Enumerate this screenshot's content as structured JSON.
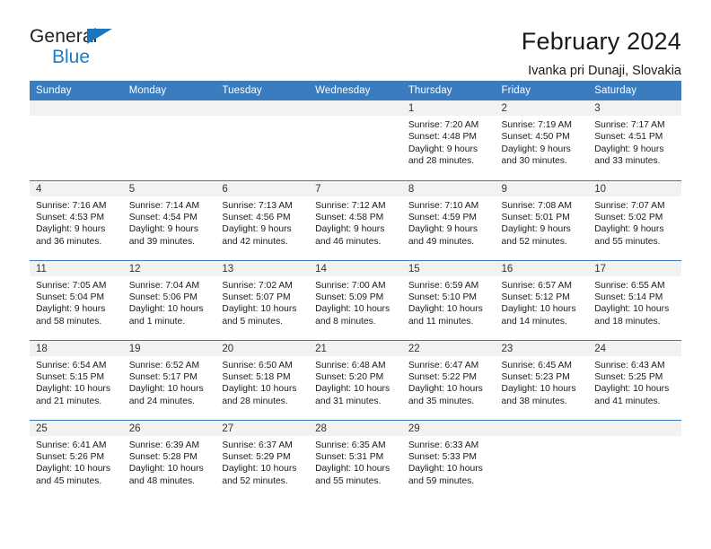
{
  "brand": {
    "name_part1": "General",
    "name_part2": "Blue",
    "triangle_color": "#1b76bd",
    "text_color": "#231f20"
  },
  "header": {
    "title": "February 2024",
    "subtitle": "Ivanka pri Dunaji, Slovakia"
  },
  "theme": {
    "header_bg": "#3a7cbd",
    "header_text": "#ffffff",
    "daynum_bg": "#f2f2f2",
    "cell_bg": "#ffffff",
    "grid_line": "#3a7cbd"
  },
  "weekday_headers": [
    "Sunday",
    "Monday",
    "Tuesday",
    "Wednesday",
    "Thursday",
    "Friday",
    "Saturday"
  ],
  "weeks": [
    [
      {
        "day": "",
        "empty": true,
        "sunrise": "",
        "sunset": "",
        "daylight_line1": "",
        "daylight_line2": ""
      },
      {
        "day": "",
        "empty": true,
        "sunrise": "",
        "sunset": "",
        "daylight_line1": "",
        "daylight_line2": ""
      },
      {
        "day": "",
        "empty": true,
        "sunrise": "",
        "sunset": "",
        "daylight_line1": "",
        "daylight_line2": ""
      },
      {
        "day": "",
        "empty": true,
        "sunrise": "",
        "sunset": "",
        "daylight_line1": "",
        "daylight_line2": ""
      },
      {
        "day": "1",
        "sunrise": "Sunrise: 7:20 AM",
        "sunset": "Sunset: 4:48 PM",
        "daylight_line1": "Daylight: 9 hours",
        "daylight_line2": "and 28 minutes."
      },
      {
        "day": "2",
        "sunrise": "Sunrise: 7:19 AM",
        "sunset": "Sunset: 4:50 PM",
        "daylight_line1": "Daylight: 9 hours",
        "daylight_line2": "and 30 minutes."
      },
      {
        "day": "3",
        "sunrise": "Sunrise: 7:17 AM",
        "sunset": "Sunset: 4:51 PM",
        "daylight_line1": "Daylight: 9 hours",
        "daylight_line2": "and 33 minutes."
      }
    ],
    [
      {
        "day": "4",
        "sunrise": "Sunrise: 7:16 AM",
        "sunset": "Sunset: 4:53 PM",
        "daylight_line1": "Daylight: 9 hours",
        "daylight_line2": "and 36 minutes."
      },
      {
        "day": "5",
        "sunrise": "Sunrise: 7:14 AM",
        "sunset": "Sunset: 4:54 PM",
        "daylight_line1": "Daylight: 9 hours",
        "daylight_line2": "and 39 minutes."
      },
      {
        "day": "6",
        "sunrise": "Sunrise: 7:13 AM",
        "sunset": "Sunset: 4:56 PM",
        "daylight_line1": "Daylight: 9 hours",
        "daylight_line2": "and 42 minutes."
      },
      {
        "day": "7",
        "sunrise": "Sunrise: 7:12 AM",
        "sunset": "Sunset: 4:58 PM",
        "daylight_line1": "Daylight: 9 hours",
        "daylight_line2": "and 46 minutes."
      },
      {
        "day": "8",
        "sunrise": "Sunrise: 7:10 AM",
        "sunset": "Sunset: 4:59 PM",
        "daylight_line1": "Daylight: 9 hours",
        "daylight_line2": "and 49 minutes."
      },
      {
        "day": "9",
        "sunrise": "Sunrise: 7:08 AM",
        "sunset": "Sunset: 5:01 PM",
        "daylight_line1": "Daylight: 9 hours",
        "daylight_line2": "and 52 minutes."
      },
      {
        "day": "10",
        "sunrise": "Sunrise: 7:07 AM",
        "sunset": "Sunset: 5:02 PM",
        "daylight_line1": "Daylight: 9 hours",
        "daylight_line2": "and 55 minutes."
      }
    ],
    [
      {
        "day": "11",
        "sunrise": "Sunrise: 7:05 AM",
        "sunset": "Sunset: 5:04 PM",
        "daylight_line1": "Daylight: 9 hours",
        "daylight_line2": "and 58 minutes."
      },
      {
        "day": "12",
        "sunrise": "Sunrise: 7:04 AM",
        "sunset": "Sunset: 5:06 PM",
        "daylight_line1": "Daylight: 10 hours",
        "daylight_line2": "and 1 minute."
      },
      {
        "day": "13",
        "sunrise": "Sunrise: 7:02 AM",
        "sunset": "Sunset: 5:07 PM",
        "daylight_line1": "Daylight: 10 hours",
        "daylight_line2": "and 5 minutes."
      },
      {
        "day": "14",
        "sunrise": "Sunrise: 7:00 AM",
        "sunset": "Sunset: 5:09 PM",
        "daylight_line1": "Daylight: 10 hours",
        "daylight_line2": "and 8 minutes."
      },
      {
        "day": "15",
        "sunrise": "Sunrise: 6:59 AM",
        "sunset": "Sunset: 5:10 PM",
        "daylight_line1": "Daylight: 10 hours",
        "daylight_line2": "and 11 minutes."
      },
      {
        "day": "16",
        "sunrise": "Sunrise: 6:57 AM",
        "sunset": "Sunset: 5:12 PM",
        "daylight_line1": "Daylight: 10 hours",
        "daylight_line2": "and 14 minutes."
      },
      {
        "day": "17",
        "sunrise": "Sunrise: 6:55 AM",
        "sunset": "Sunset: 5:14 PM",
        "daylight_line1": "Daylight: 10 hours",
        "daylight_line2": "and 18 minutes."
      }
    ],
    [
      {
        "day": "18",
        "sunrise": "Sunrise: 6:54 AM",
        "sunset": "Sunset: 5:15 PM",
        "daylight_line1": "Daylight: 10 hours",
        "daylight_line2": "and 21 minutes."
      },
      {
        "day": "19",
        "sunrise": "Sunrise: 6:52 AM",
        "sunset": "Sunset: 5:17 PM",
        "daylight_line1": "Daylight: 10 hours",
        "daylight_line2": "and 24 minutes."
      },
      {
        "day": "20",
        "sunrise": "Sunrise: 6:50 AM",
        "sunset": "Sunset: 5:18 PM",
        "daylight_line1": "Daylight: 10 hours",
        "daylight_line2": "and 28 minutes."
      },
      {
        "day": "21",
        "sunrise": "Sunrise: 6:48 AM",
        "sunset": "Sunset: 5:20 PM",
        "daylight_line1": "Daylight: 10 hours",
        "daylight_line2": "and 31 minutes."
      },
      {
        "day": "22",
        "sunrise": "Sunrise: 6:47 AM",
        "sunset": "Sunset: 5:22 PM",
        "daylight_line1": "Daylight: 10 hours",
        "daylight_line2": "and 35 minutes."
      },
      {
        "day": "23",
        "sunrise": "Sunrise: 6:45 AM",
        "sunset": "Sunset: 5:23 PM",
        "daylight_line1": "Daylight: 10 hours",
        "daylight_line2": "and 38 minutes."
      },
      {
        "day": "24",
        "sunrise": "Sunrise: 6:43 AM",
        "sunset": "Sunset: 5:25 PM",
        "daylight_line1": "Daylight: 10 hours",
        "daylight_line2": "and 41 minutes."
      }
    ],
    [
      {
        "day": "25",
        "sunrise": "Sunrise: 6:41 AM",
        "sunset": "Sunset: 5:26 PM",
        "daylight_line1": "Daylight: 10 hours",
        "daylight_line2": "and 45 minutes."
      },
      {
        "day": "26",
        "sunrise": "Sunrise: 6:39 AM",
        "sunset": "Sunset: 5:28 PM",
        "daylight_line1": "Daylight: 10 hours",
        "daylight_line2": "and 48 minutes."
      },
      {
        "day": "27",
        "sunrise": "Sunrise: 6:37 AM",
        "sunset": "Sunset: 5:29 PM",
        "daylight_line1": "Daylight: 10 hours",
        "daylight_line2": "and 52 minutes."
      },
      {
        "day": "28",
        "sunrise": "Sunrise: 6:35 AM",
        "sunset": "Sunset: 5:31 PM",
        "daylight_line1": "Daylight: 10 hours",
        "daylight_line2": "and 55 minutes."
      },
      {
        "day": "29",
        "sunrise": "Sunrise: 6:33 AM",
        "sunset": "Sunset: 5:33 PM",
        "daylight_line1": "Daylight: 10 hours",
        "daylight_line2": "and 59 minutes."
      },
      {
        "day": "",
        "empty": true,
        "sunrise": "",
        "sunset": "",
        "daylight_line1": "",
        "daylight_line2": ""
      },
      {
        "day": "",
        "empty": true,
        "sunrise": "",
        "sunset": "",
        "daylight_line1": "",
        "daylight_line2": ""
      }
    ]
  ]
}
